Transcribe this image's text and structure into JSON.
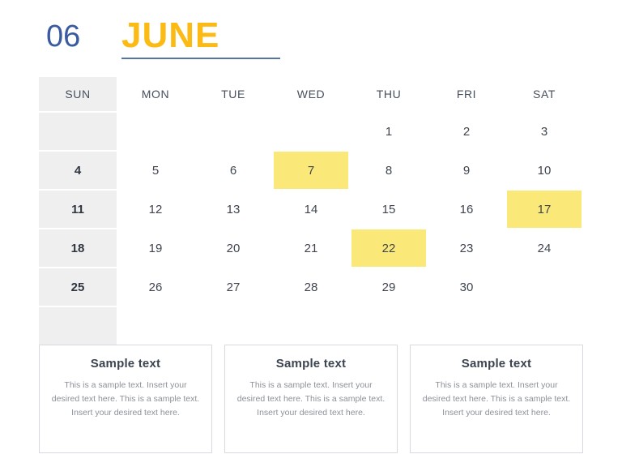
{
  "header": {
    "month_number": "06",
    "month_name": "JUNE",
    "number_color": "#3a5ba0",
    "name_color": "#fcbb14",
    "underline_color": "#55749f"
  },
  "calendar": {
    "weekdays": [
      "SUN",
      "MON",
      "TUE",
      "WED",
      "THU",
      "FRI",
      "SAT"
    ],
    "highlight_color": "#fae979",
    "sunday_column_color": "#efefef",
    "rows": [
      [
        "",
        "",
        "",
        "",
        "1",
        "2",
        "3"
      ],
      [
        "4",
        "5",
        "6",
        "7",
        "8",
        "9",
        "10"
      ],
      [
        "11",
        "12",
        "13",
        "14",
        "15",
        "16",
        "17"
      ],
      [
        "18",
        "19",
        "20",
        "21",
        "22",
        "23",
        "24"
      ],
      [
        "25",
        "26",
        "27",
        "28",
        "29",
        "30",
        ""
      ],
      [
        "",
        "",
        "",
        "",
        "",
        "",
        ""
      ]
    ],
    "highlighted_days": [
      "7",
      "17",
      "22"
    ]
  },
  "cards": [
    {
      "title": "Sample text",
      "body": "This is a sample text. Insert your desired text here. This is a sample text. Insert your desired text here."
    },
    {
      "title": "Sample text",
      "body": "This is a sample text. Insert your desired text here. This is a sample text. Insert your desired text here."
    },
    {
      "title": "Sample text",
      "body": "This is a sample text. Insert your desired text here. This is a sample text. Insert your desired text here."
    }
  ]
}
